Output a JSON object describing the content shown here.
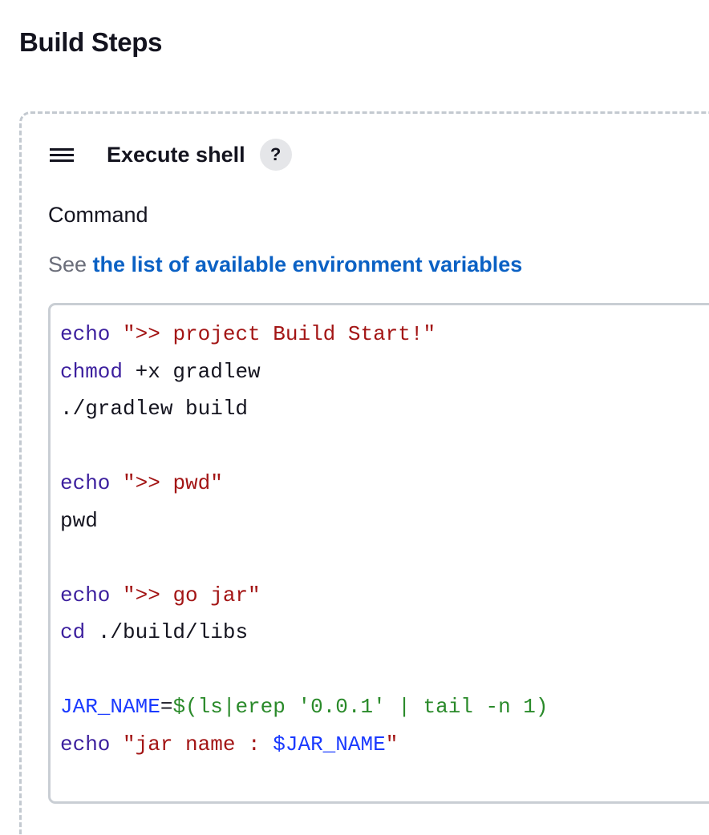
{
  "section": {
    "title": "Build Steps"
  },
  "step": {
    "title": "Execute shell",
    "help_label": "?",
    "drag_icon": "hamburger-icon"
  },
  "field": {
    "label": "Command",
    "desc_prefix": "See ",
    "desc_link": "the list of available environment variables"
  },
  "colors": {
    "keyword": "#3c1f9e",
    "string": "#a31515",
    "variable": "#1a3aff",
    "substitution": "#2a8a2a",
    "link": "#0b61c4"
  },
  "command": {
    "lines": [
      {
        "segments": [
          {
            "t": "kw",
            "text": "echo"
          },
          {
            "t": "plain",
            "text": " "
          },
          {
            "t": "str",
            "text": "\">> project Build Start!\""
          }
        ]
      },
      {
        "segments": [
          {
            "t": "kw",
            "text": "chmod"
          },
          {
            "t": "plain",
            "text": " +x gradlew"
          }
        ]
      },
      {
        "segments": [
          {
            "t": "plain",
            "text": "./gradlew build"
          }
        ]
      },
      {
        "segments": []
      },
      {
        "segments": [
          {
            "t": "kw",
            "text": "echo"
          },
          {
            "t": "plain",
            "text": " "
          },
          {
            "t": "str",
            "text": "\">> pwd\""
          }
        ]
      },
      {
        "segments": [
          {
            "t": "plain",
            "text": "pwd"
          }
        ]
      },
      {
        "segments": []
      },
      {
        "segments": [
          {
            "t": "kw",
            "text": "echo"
          },
          {
            "t": "plain",
            "text": " "
          },
          {
            "t": "str",
            "text": "\">> go jar\""
          }
        ]
      },
      {
        "segments": [
          {
            "t": "kw",
            "text": "cd"
          },
          {
            "t": "plain",
            "text": " ./build/libs"
          }
        ]
      },
      {
        "segments": []
      },
      {
        "segments": [
          {
            "t": "var",
            "text": "JAR_NAME"
          },
          {
            "t": "plain",
            "text": "="
          },
          {
            "t": "sub",
            "text": "$(ls|erep '0.0.1' | tail -n 1)"
          }
        ]
      },
      {
        "segments": [
          {
            "t": "kw",
            "text": "echo"
          },
          {
            "t": "plain",
            "text": " "
          },
          {
            "t": "str",
            "text": "\"jar name : "
          },
          {
            "t": "var",
            "text": "$JAR_NAME"
          },
          {
            "t": "str",
            "text": "\""
          }
        ]
      }
    ]
  }
}
